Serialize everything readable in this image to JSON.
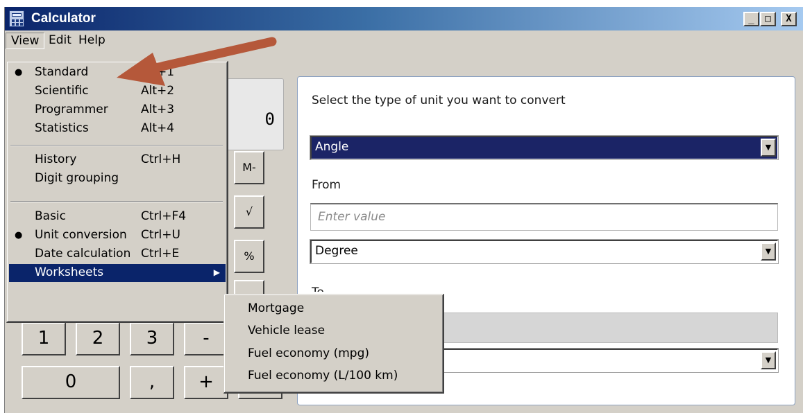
{
  "window": {
    "title": "Calculator",
    "controls": {
      "minimize": "_",
      "maximize": "□",
      "close": "X"
    }
  },
  "menubar": {
    "view": "View",
    "edit": "Edit",
    "help": "Help"
  },
  "view_menu": {
    "items": [
      {
        "label": "Standard",
        "shortcut": "Alt+1",
        "checked": true
      },
      {
        "label": "Scientific",
        "shortcut": "Alt+2",
        "checked": false
      },
      {
        "label": "Programmer",
        "shortcut": "Alt+3",
        "checked": false
      },
      {
        "label": "Statistics",
        "shortcut": "Alt+4",
        "checked": false
      },
      {
        "label": "History",
        "shortcut": "Ctrl+H",
        "checked": false
      },
      {
        "label": "Digit grouping",
        "shortcut": "",
        "checked": false
      },
      {
        "label": "Basic",
        "shortcut": "Ctrl+F4",
        "checked": false
      },
      {
        "label": "Unit conversion",
        "shortcut": "Ctrl+U",
        "checked": true
      },
      {
        "label": "Date calculation",
        "shortcut": "Ctrl+E",
        "checked": false
      },
      {
        "label": "Worksheets",
        "shortcut": "",
        "checked": false,
        "highlighted": true
      }
    ],
    "bullet": "●",
    "submenu_arrow": "▶"
  },
  "worksheets_submenu": {
    "items": [
      "Mortgage",
      "Vehicle lease",
      "Fuel economy (mpg)",
      "Fuel economy (L/100 km)"
    ]
  },
  "calculator": {
    "display_value": "0",
    "buttons": {
      "mem_minus": "M-",
      "sqrt": "√",
      "percent": "%",
      "one": "1",
      "two": "2",
      "three": "3",
      "minus": "-",
      "zero": "0",
      "decimal": ",",
      "plus": "+"
    }
  },
  "converter": {
    "prompt": "Select the type of unit you want to convert",
    "unit_type": "Angle",
    "from_label": "From",
    "from_placeholder": "Enter value",
    "from_unit": "Degree",
    "to_label_partial": "To",
    "dropdown_arrow": "▼"
  },
  "annotation": {
    "arrow_color": "#b5583a"
  },
  "colors": {
    "title_gradient_start": "#0a246a",
    "title_gradient_end": "#a6caf0",
    "selection_navy": "#1b2466",
    "menu_highlight": "#0a246a",
    "face": "#d4d0c8"
  }
}
